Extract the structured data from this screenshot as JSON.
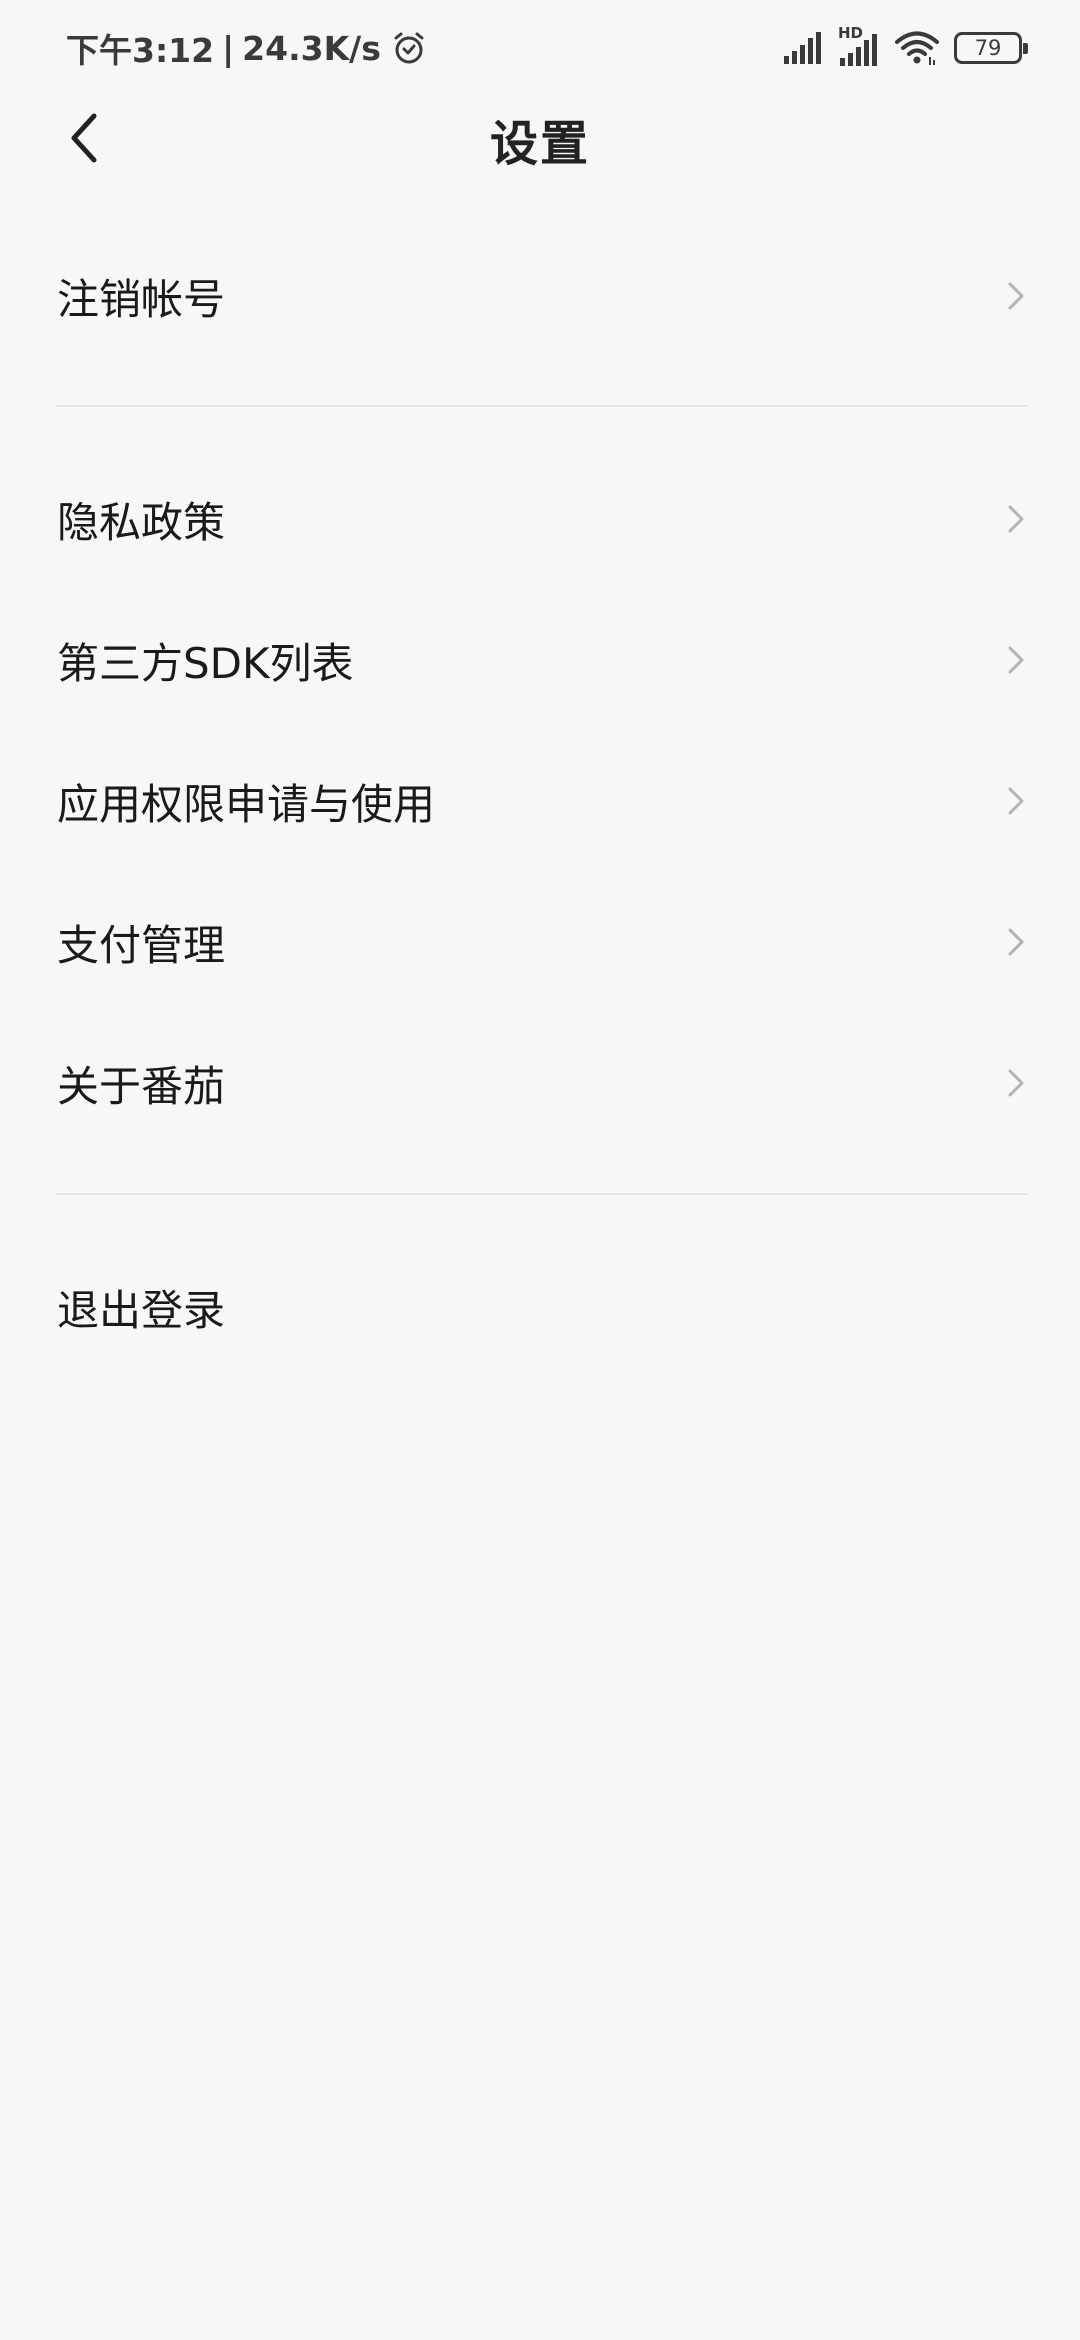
{
  "status_bar": {
    "time": "下午3:12",
    "separator": "|",
    "net_speed": "24.3K/s",
    "network_badge": "HD",
    "battery_level": "79",
    "icons": [
      "alarm-icon",
      "signal-icon",
      "hd-signal-icon",
      "wifi-icon",
      "battery-icon"
    ]
  },
  "header": {
    "title": "设置",
    "back_icon": "back-arrow-icon"
  },
  "settings": {
    "deregister_account": "注销帐号",
    "privacy_policy": "隐私政策",
    "third_party_sdk": "第三方SDK列表",
    "app_permissions": "应用权限申请与使用",
    "payment_management": "支付管理",
    "about": "关于番茄",
    "logout": "退出登录"
  },
  "colors": {
    "background": "#f7f7f7",
    "text": "#1a1a1a",
    "chevron": "#b3b3b3",
    "divider": "#e8e8e8"
  }
}
